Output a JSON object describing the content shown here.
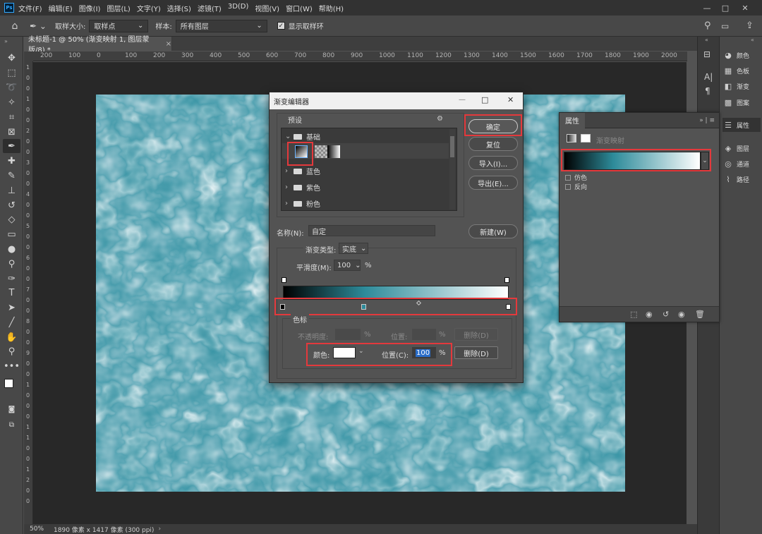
{
  "app": {
    "logo": "Ps"
  },
  "menu": [
    "文件(F)",
    "编辑(E)",
    "图像(I)",
    "图层(L)",
    "文字(Y)",
    "选择(S)",
    "滤镜(T)",
    "3D(D)",
    "视图(V)",
    "窗口(W)",
    "帮助(H)"
  ],
  "window_controls": [
    "—",
    "□",
    "✕"
  ],
  "options": {
    "sample_size_label": "取样大小:",
    "sample_size_value": "取样点",
    "sample_label": "样本:",
    "sample_value": "所有图层",
    "show_ring_label": "显示取样环"
  },
  "document": {
    "tab_title": "未标题-1 @ 50% (渐变映射 1, 图层蒙版/8) *",
    "close": "×"
  },
  "ruler_h": [
    "200",
    "100",
    "0",
    "100",
    "200",
    "300",
    "400",
    "500",
    "600",
    "700",
    "800",
    "900",
    "1000",
    "1100",
    "1200",
    "1300",
    "1400",
    "1500",
    "1600",
    "1700",
    "1800",
    "1900",
    "2000"
  ],
  "ruler_v": [
    "1",
    "0",
    "0",
    "1",
    "0",
    "0",
    "2",
    "0",
    "0",
    "3",
    "0",
    "0",
    "4",
    "0",
    "0",
    "5",
    "0",
    "0",
    "6",
    "0",
    "0",
    "7",
    "0",
    "0",
    "8",
    "0",
    "0",
    "9",
    "0",
    "0",
    "1",
    "0",
    "0",
    "0",
    "1",
    "1",
    "0",
    "0",
    "1",
    "2",
    "0",
    "0"
  ],
  "status": {
    "zoom": "50%",
    "info": "1890 像素 x 1417 像素 (300 ppi)"
  },
  "right_dock": [
    {
      "icon": "palette-icon",
      "glyph": "◕",
      "label": "颜色"
    },
    {
      "icon": "swatches-icon",
      "glyph": "▦",
      "label": "色板"
    },
    {
      "icon": "gradient-icon",
      "glyph": "◧",
      "label": "渐变"
    },
    {
      "icon": "pattern-icon",
      "glyph": "▩",
      "label": "图案"
    },
    {
      "icon": "properties-icon",
      "glyph": "☰",
      "label": "属性"
    },
    {
      "icon": "layers-icon",
      "glyph": "◈",
      "label": "图层"
    },
    {
      "icon": "channels-icon",
      "glyph": "◎",
      "label": "通道"
    },
    {
      "icon": "paths-icon",
      "glyph": "⌇",
      "label": "路径"
    }
  ],
  "properties": {
    "tab": "属性",
    "adjustment": "渐变映射",
    "dither_label": "仿色",
    "reverse_label": "反向",
    "header_icons": "»  |  ≡"
  },
  "gradient_editor": {
    "title": "渐变编辑器",
    "presets_label": "预设",
    "folders": [
      "基础",
      "蓝色",
      "紫色",
      "粉色"
    ],
    "buttons": {
      "ok": "确定",
      "reset": "复位",
      "import": "导入(I)...",
      "export": "导出(E)...",
      "new": "新建(W)",
      "delete_opacity": "删除(D)",
      "delete_color": "删除(D)"
    },
    "name_label": "名称(N):",
    "name_value": "自定",
    "type_label": "渐变类型:",
    "type_value": "实底",
    "smooth_label": "平滑度(M):",
    "smooth_value": "100",
    "percent": "%",
    "stops_group": "色标",
    "opacity_label": "不透明度:",
    "position_label": "位置:",
    "color_label": "颜色:",
    "color_position_label": "位置(C):",
    "color_position_value": "100",
    "color_value": "#ffffff",
    "color_stop_positions": [
      0,
      0.36,
      1
    ],
    "midpoint_position": 0.6
  },
  "colors": {
    "gradient_start": "#000000",
    "gradient_mid": "#2d8b9a",
    "gradient_end": "#ffffff",
    "highlight": "#e4393c",
    "texture_base": "#2e8fa0"
  }
}
